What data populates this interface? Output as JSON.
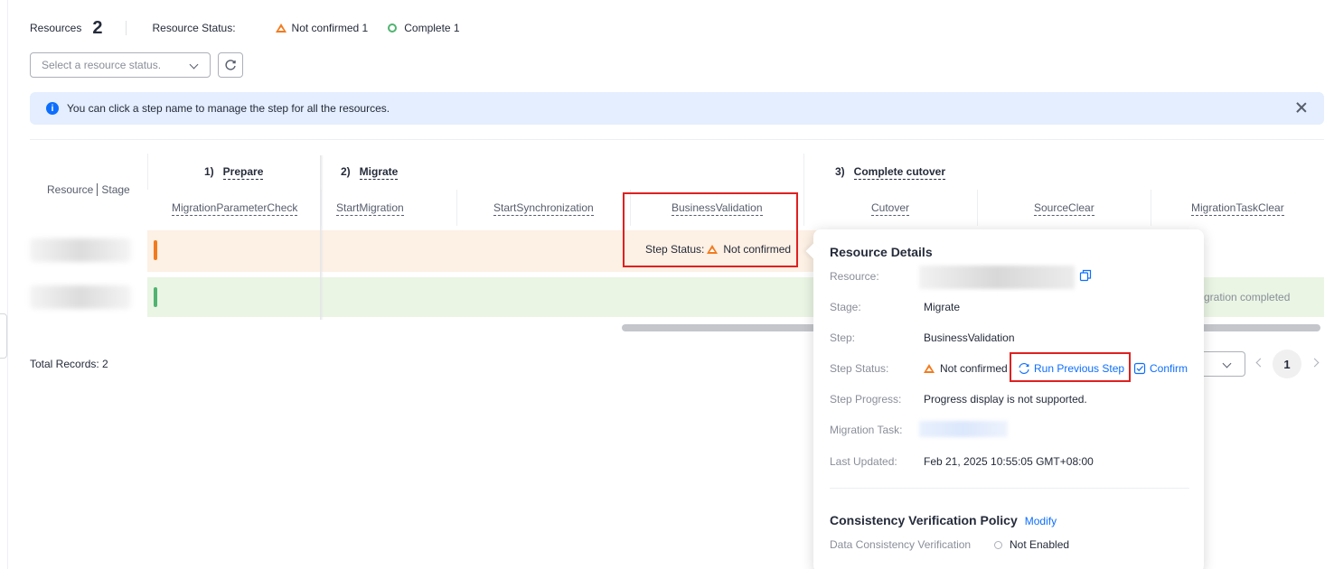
{
  "summary": {
    "resources_label": "Resources",
    "resources_count": "2",
    "status_label": "Resource Status:",
    "not_confirmed": "Not confirmed 1",
    "complete": "Complete 1"
  },
  "filter": {
    "placeholder": "Select a resource status."
  },
  "info": {
    "message": "You can click a step name to manage the step for all the resources."
  },
  "table": {
    "resource_stage_header": {
      "resource": "Resource",
      "stage": "Stage"
    },
    "stages": [
      {
        "num": "1)",
        "name": "Prepare"
      },
      {
        "num": "2)",
        "name": "Migrate"
      },
      {
        "num": "3)",
        "name": "Complete cutover"
      }
    ],
    "steps": [
      "MigrationParameterCheck",
      "StartMigration",
      "StartSynchronization",
      "BusinessValidation",
      "Cutover",
      "SourceClear",
      "MigrationTaskClear"
    ],
    "row1": {
      "step_status_label": "Step Status:",
      "step_status_value": "Not confirmed"
    },
    "row2": {
      "status_text": "gration completed"
    },
    "total_records": "Total Records: 2"
  },
  "pagination": {
    "current_page": "1"
  },
  "popover": {
    "title": "Resource Details",
    "labels": {
      "resource": "Resource:",
      "stage": "Stage:",
      "step": "Step:",
      "step_status": "Step Status:",
      "step_progress": "Step Progress:",
      "migration_task": "Migration Task:",
      "last_updated": "Last Updated:"
    },
    "values": {
      "stage": "Migrate",
      "step": "BusinessValidation",
      "step_status": "Not confirmed",
      "step_progress": "Progress display is not supported.",
      "last_updated": "Feb 21, 2025 10:55:05 GMT+08:00"
    },
    "actions": {
      "run_previous_step": "Run Previous Step",
      "confirm": "Confirm"
    },
    "policy": {
      "title": "Consistency Verification Policy",
      "modify": "Modify",
      "data_consistency_label": "Data Consistency Verification",
      "data_consistency_value": "Not Enabled"
    }
  },
  "colors": {
    "warning": "#f27b1e",
    "success": "#50b370",
    "primary": "#0d6efd",
    "highlight_box": "#e02020"
  }
}
